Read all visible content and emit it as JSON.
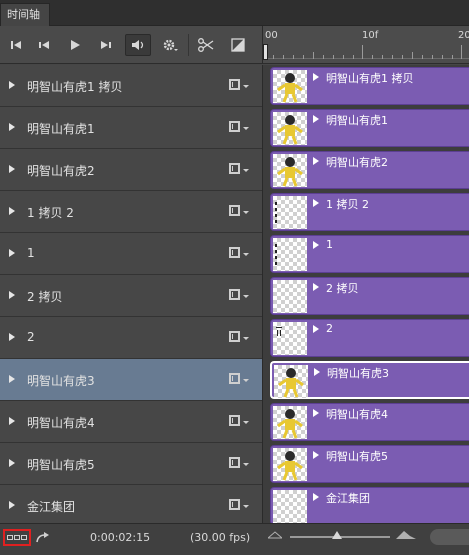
{
  "panel": {
    "tab_label": "时间轴"
  },
  "ruler": {
    "labels": [
      "00",
      "10f",
      "20"
    ]
  },
  "layers": [
    {
      "name": "明智山有虎1 拷贝",
      "selected": false,
      "thumb": "figure"
    },
    {
      "name": "明智山有虎1",
      "selected": false,
      "thumb": "figure"
    },
    {
      "name": "明智山有虎2",
      "selected": false,
      "thumb": "figure"
    },
    {
      "name": "1 拷贝 2",
      "selected": false,
      "thumb": "text-left"
    },
    {
      "name": "1",
      "selected": false,
      "thumb": "text-left"
    },
    {
      "name": "2 拷贝",
      "selected": false,
      "thumb": "blank"
    },
    {
      "name": "2",
      "selected": false,
      "thumb": "text-small"
    },
    {
      "name": "明智山有虎3",
      "selected": true,
      "thumb": "figure"
    },
    {
      "name": "明智山有虎4",
      "selected": false,
      "thumb": "figure"
    },
    {
      "name": "明智山有虎5",
      "selected": false,
      "thumb": "figure"
    },
    {
      "name": "金江集团",
      "selected": false,
      "thumb": "blank"
    }
  ],
  "status": {
    "timecode": "0:00:02:15",
    "fps": "(30.00 fps)"
  },
  "colors": {
    "clip": "#7b5cb2",
    "selected_row": "#687b92",
    "highlight_box": "#e02020"
  }
}
